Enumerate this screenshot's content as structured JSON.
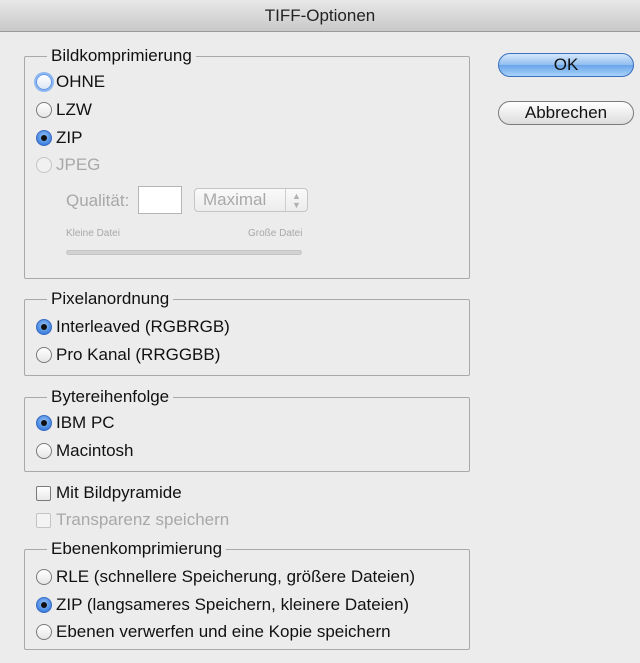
{
  "dialog": {
    "title": "TIFF-Optionen"
  },
  "buttons": {
    "ok": "OK",
    "cancel": "Abbrechen"
  },
  "image_compression": {
    "legend": "Bildkomprimierung",
    "options": [
      "OHNE",
      "LZW",
      "ZIP",
      "JPEG"
    ],
    "selected": "ZIP",
    "quality_label": "Qualität:",
    "quality_value": "",
    "quality_select": "Maximal",
    "small_file": "Kleine Datei",
    "large_file": "Große Datei"
  },
  "pixel_order": {
    "legend": "Pixelanordnung",
    "options": [
      "Interleaved (RGBRGB)",
      "Pro Kanal (RRGGBB)"
    ],
    "selected": "Interleaved (RGBRGB)"
  },
  "byte_order": {
    "legend": "Bytereihenfolge",
    "options": [
      "IBM PC",
      "Macintosh"
    ],
    "selected": "IBM PC"
  },
  "checkboxes": {
    "pyramid": "Mit Bildpyramide",
    "pyramid_checked": false,
    "transparency": "Transparenz speichern",
    "transparency_checked": false
  },
  "layer_compression": {
    "legend": "Ebenenkomprimierung",
    "options": [
      "RLE (schnellere Speicherung, größere Dateien)",
      "ZIP (langsameres Speichern, kleinere Dateien)",
      "Ebenen verwerfen und eine Kopie speichern"
    ],
    "selected": "ZIP (langsameres Speichern, kleinere Dateien)"
  }
}
